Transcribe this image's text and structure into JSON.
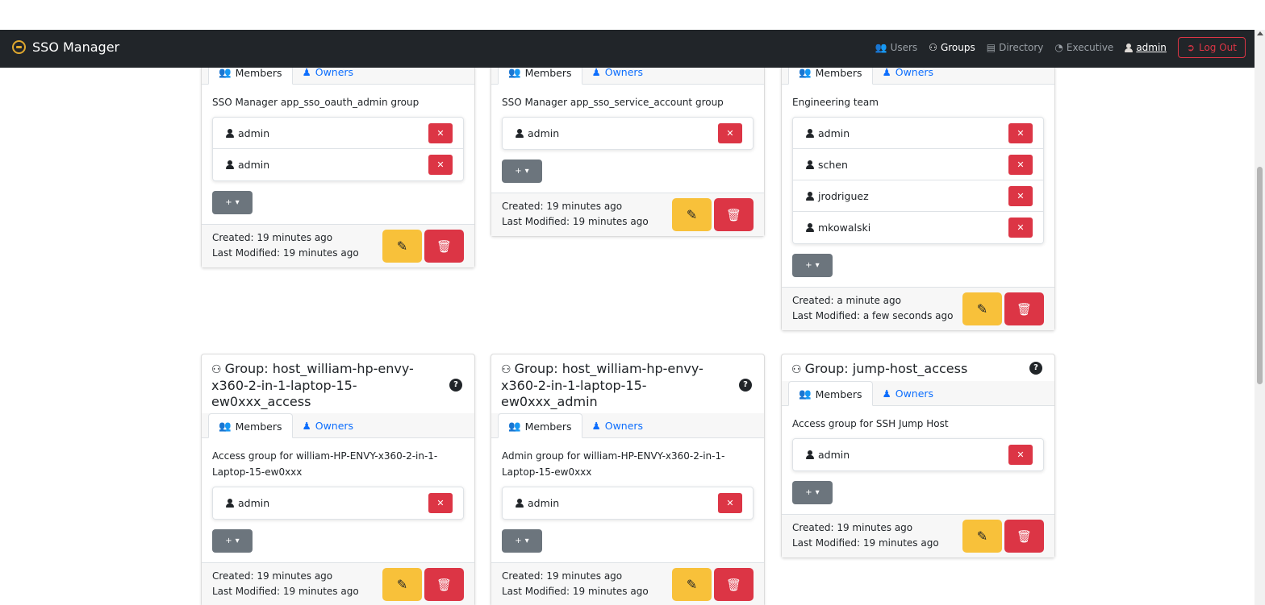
{
  "app": {
    "title": "SSO Manager"
  },
  "nav": {
    "users": "Users",
    "groups": "Groups",
    "directory": "Directory",
    "executive": "Executive",
    "user": "admin",
    "logout": "Log Out"
  },
  "labels": {
    "members_tab": "Members",
    "owners_tab": "Owners"
  },
  "cards": [
    {
      "title": "",
      "description": "SSO Manager app_sso_oauth_admin group",
      "members": [
        "admin",
        "admin"
      ],
      "created": "Created: 19 minutes ago",
      "modified": "Last Modified: 19 minutes ago"
    },
    {
      "title": "",
      "description": "SSO Manager app_sso_service_account group",
      "members": [
        "admin"
      ],
      "created": "Created: 19 minutes ago",
      "modified": "Last Modified: 19 minutes ago"
    },
    {
      "title": "",
      "description": "Engineering team",
      "members": [
        "admin",
        "schen",
        "jrodriguez",
        "mkowalski"
      ],
      "created": "Created: a minute ago",
      "modified": "Last Modified: a few seconds ago"
    },
    {
      "title": "Group: host_william-hp-envy-x360-2-in-1-laptop-15-ew0xxx_access",
      "description": "Access group for william-HP-ENVY-x360-2-in-1-Laptop-15-ew0xxx",
      "members": [
        "admin"
      ],
      "created": "Created: 19 minutes ago",
      "modified": "Last Modified: 19 minutes ago"
    },
    {
      "title": "Group: host_william-hp-envy-x360-2-in-1-laptop-15-ew0xxx_admin",
      "description": "Admin group for william-HP-ENVY-x360-2-in-1-Laptop-15-ew0xxx",
      "members": [
        "admin"
      ],
      "created": "Created: 19 minutes ago",
      "modified": "Last Modified: 19 minutes ago"
    },
    {
      "title": "Group: jump-host_access",
      "description": "Access group for SSH Jump Host",
      "members": [
        "admin"
      ],
      "created": "Created: 19 minutes ago",
      "modified": "Last Modified: 19 minutes ago"
    }
  ]
}
